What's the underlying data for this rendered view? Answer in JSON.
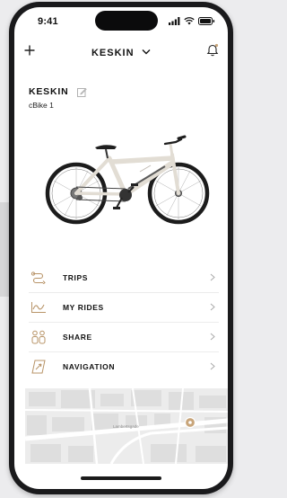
{
  "status_bar": {
    "time": "9:41"
  },
  "header": {
    "title": "KESKIN"
  },
  "bike": {
    "name": "KESKIN",
    "model": "cBike 1"
  },
  "menu": [
    {
      "label": "TRIPS",
      "icon": "trips-icon"
    },
    {
      "label": "MY RIDES",
      "icon": "my-rides-icon"
    },
    {
      "label": "SHARE",
      "icon": "share-icon"
    },
    {
      "label": "NAVIGATION",
      "icon": "navigation-icon"
    }
  ],
  "map": {
    "street_label": "Lambertsgade"
  },
  "colors": {
    "accent": "#c8a57a",
    "text": "#111111",
    "icon_gold": "#b89468"
  }
}
